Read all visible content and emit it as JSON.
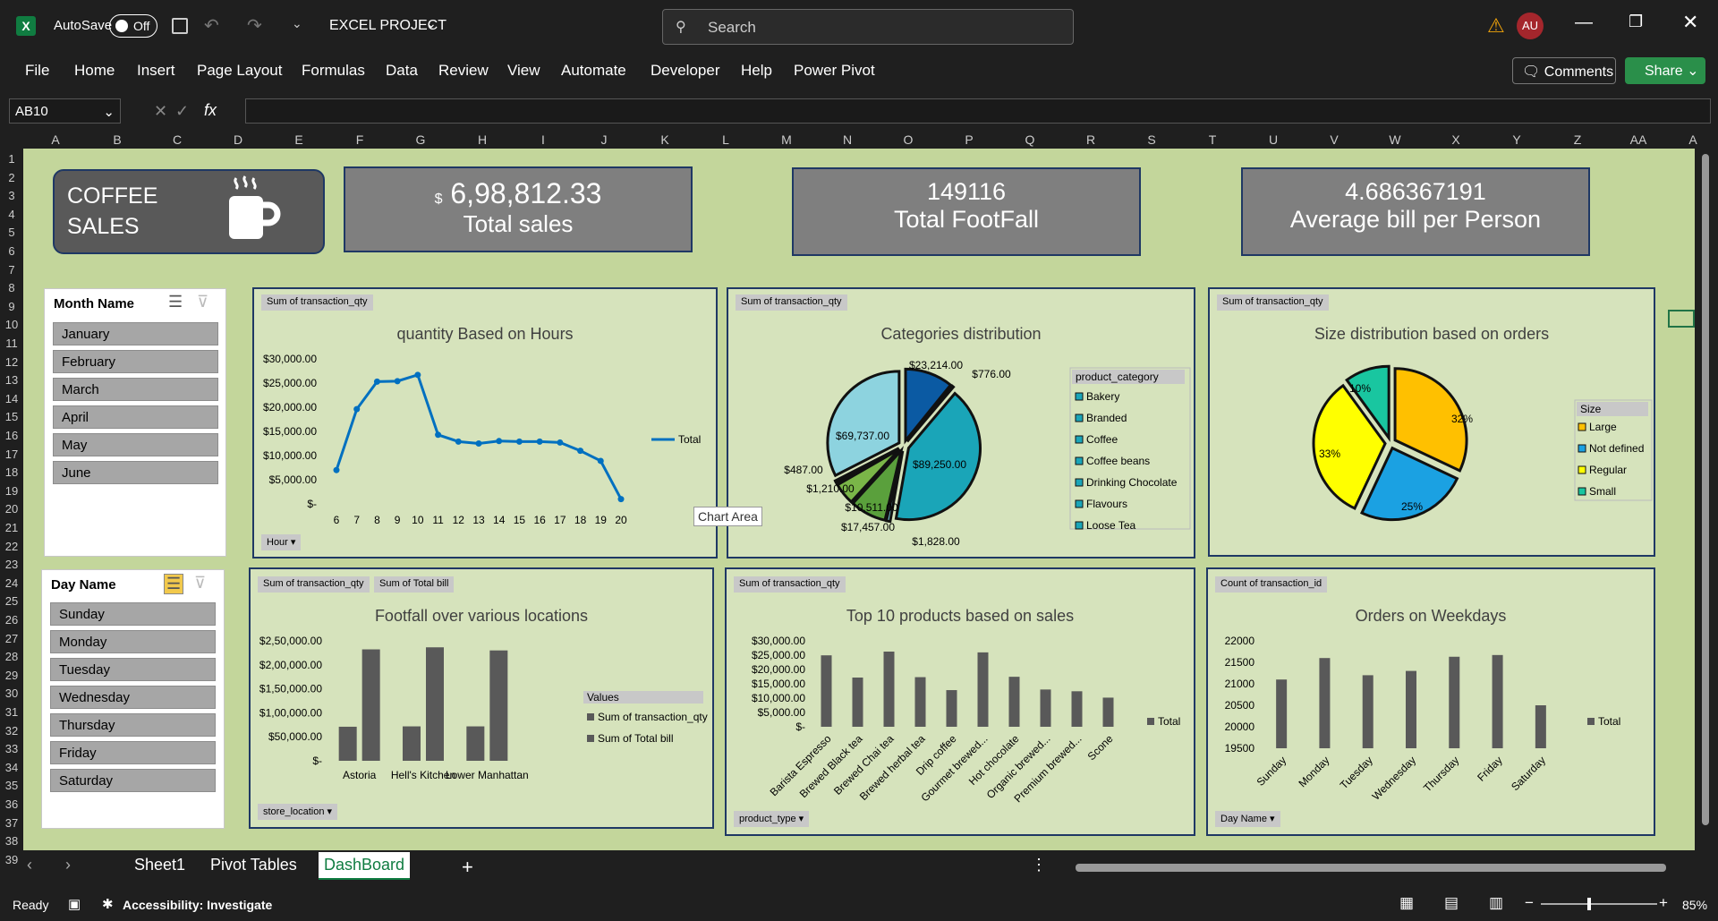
{
  "app": {
    "autosave_label": "AutoSave",
    "autosave_state": "Off",
    "filename": "EXCEL PROJECT",
    "search_placeholder": "Search",
    "avatar": "AU"
  },
  "menu": [
    "File",
    "Home",
    "Insert",
    "Page Layout",
    "Formulas",
    "Data",
    "Review",
    "View",
    "Automate",
    "Developer",
    "Help",
    "Power Pivot"
  ],
  "buttons": {
    "comments": "Comments",
    "share": "Share"
  },
  "formula": {
    "namebox": "AB10",
    "value": ""
  },
  "columns": [
    "A",
    "B",
    "C",
    "D",
    "E",
    "F",
    "G",
    "H",
    "I",
    "J",
    "K",
    "L",
    "M",
    "N",
    "O",
    "P",
    "Q",
    "R",
    "S",
    "T",
    "U",
    "V",
    "W",
    "X",
    "Y",
    "Z",
    "AA",
    "A"
  ],
  "rows": [
    "1",
    "2",
    "3",
    "4",
    "5",
    "6",
    "7",
    "8",
    "9",
    "10",
    "11",
    "12",
    "13",
    "14",
    "15",
    "16",
    "17",
    "18",
    "19",
    "20",
    "21",
    "22",
    "23",
    "24",
    "25",
    "26",
    "27",
    "28",
    "29",
    "30",
    "31",
    "32",
    "33",
    "34",
    "35",
    "36",
    "37",
    "38",
    "39"
  ],
  "kpis": {
    "brand_line1": "COFFEE",
    "brand_line2": "SALES",
    "sales_currency": "$",
    "sales_value": "6,98,812.33",
    "sales_label": "Total sales",
    "footfall_value": "149116",
    "footfall_label": "Total FootFall",
    "avg_value": "4.686367191",
    "avg_label": "Average bill per Person"
  },
  "slicers": {
    "month": {
      "title": "Month Name",
      "items": [
        "January",
        "February",
        "March",
        "April",
        "May",
        "June"
      ]
    },
    "day": {
      "title": "Day Name",
      "items": [
        "Sunday",
        "Monday",
        "Tuesday",
        "Wednesday",
        "Thursday",
        "Friday",
        "Saturday"
      ]
    }
  },
  "tooltip": "Chart Area",
  "sheets": [
    "Sheet1",
    "Pivot Tables",
    "DashBoard"
  ],
  "status": {
    "ready": "Ready",
    "accessibility": "Accessibility: Investigate",
    "zoom": "85%"
  },
  "chart_data": [
    {
      "type": "line",
      "title": "quantity Based on Hours",
      "field": "Sum of transaction_qty",
      "axis_field": "Hour",
      "categories": [
        "6",
        "7",
        "8",
        "9",
        "10",
        "11",
        "12",
        "13",
        "14",
        "15",
        "16",
        "17",
        "18",
        "19",
        "20"
      ],
      "series": [
        {
          "name": "Total",
          "values": [
            7000,
            19600,
            25300,
            25400,
            26700,
            14300,
            12900,
            12500,
            13000,
            12900,
            12900,
            12700,
            11000,
            8900,
            1000
          ]
        }
      ],
      "yticks": [
        "$30,000.00",
        "$25,000.00",
        "$20,000.00",
        "$15,000.00",
        "$10,000.00",
        "$5,000.00",
        "$-"
      ],
      "ylim": [
        0,
        30000
      ]
    },
    {
      "type": "pie",
      "title": "Categories distribution",
      "field": "Sum of transaction_qty",
      "legend_title": "product_category",
      "legend": [
        "Bakery",
        "Branded",
        "Coffee",
        "Coffee beans",
        "Drinking Chocolate",
        "Flavours",
        "Loose Tea"
      ],
      "labels": [
        "$23,214.00",
        "$776.00",
        "$89,250.00",
        "$1,828.00",
        "$17,457.00",
        "$10,511.00",
        "$1,210.00",
        "$487.00",
        "$69,737.00"
      ],
      "values": [
        23214,
        776,
        89250,
        1828,
        17457,
        10511,
        1210,
        487,
        69737
      ]
    },
    {
      "type": "pie",
      "title": "Size distribution based on orders",
      "field": "Sum of transaction_qty",
      "legend_title": "Size",
      "legend": [
        "Large",
        "Not defined",
        "Regular",
        "Small"
      ],
      "labels": [
        "32%",
        "25%",
        "33%",
        "10%"
      ],
      "values": [
        32,
        25,
        33,
        10
      ]
    },
    {
      "type": "bar",
      "title": "Footfall over various locations",
      "fields": [
        "Sum of transaction_qty",
        "Sum of Total bill"
      ],
      "axis_field": "store_location",
      "legend_title": "Values",
      "categories": [
        "Astoria",
        "Hell's Kitchen",
        "Lower Manhattan"
      ],
      "series": [
        {
          "name": "Sum of transaction_qty",
          "values": [
            70991,
            71737,
            71742
          ]
        },
        {
          "name": "Sum of Total bill",
          "values": [
            232243,
            236511,
            230057
          ]
        }
      ],
      "yticks": [
        "$2,50,000.00",
        "$2,00,000.00",
        "$1,50,000.00",
        "$1,00,000.00",
        "$50,000.00",
        "$-"
      ],
      "ylim": [
        0,
        250000
      ]
    },
    {
      "type": "bar",
      "title": "Top 10 products based on sales",
      "field": "Sum of transaction_qty",
      "axis_field": "product_type",
      "categories": [
        "Barista Espresso",
        "Brewed Black tea",
        "Brewed Chai tea",
        "Brewed herbal tea",
        "Drip coffee",
        "Gourmet brewed...",
        "Hot chocolate",
        "Organic brewed...",
        "Premium brewed...",
        "Scone"
      ],
      "series": [
        {
          "name": "Total",
          "values": [
            24943,
            17183,
            26250,
            17328,
            12800,
            25973,
            17457,
            13012,
            12400,
            10173
          ]
        }
      ],
      "yticks": [
        "$30,000.00",
        "$25,000.00",
        "$20,000.00",
        "$15,000.00",
        "$10,000.00",
        "$5,000.00",
        "$-"
      ],
      "ylim": [
        0,
        30000
      ]
    },
    {
      "type": "bar",
      "title": "Orders on Weekdays",
      "field": "Count of transaction_id",
      "axis_field": "Day Name",
      "categories": [
        "Sunday",
        "Monday",
        "Tuesday",
        "Wednesday",
        "Thursday",
        "Friday",
        "Saturday"
      ],
      "series": [
        {
          "name": "Total",
          "values": [
            21100,
            21600,
            21200,
            21300,
            21630,
            21670,
            20500
          ]
        }
      ],
      "yticks": [
        "22000",
        "21500",
        "21000",
        "20500",
        "20000",
        "19500"
      ],
      "ylim": [
        19500,
        22000
      ]
    }
  ]
}
